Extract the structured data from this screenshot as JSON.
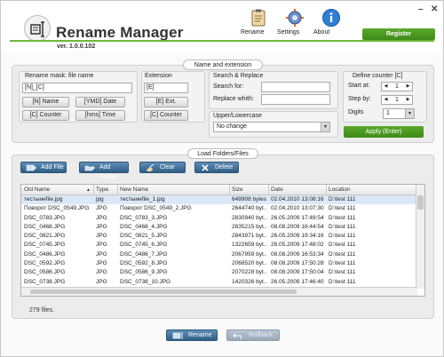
{
  "app": {
    "title": "Rename Manager",
    "version": "ver. 1.0.0.102",
    "window_minimize": "–",
    "window_close": "✕"
  },
  "toolbar": {
    "rename_label": "Rename",
    "settings_label": "Settings",
    "about_label": "About",
    "register_label": "Register"
  },
  "name_ext": {
    "group_title": "Name and extension",
    "mask_label": "Rename mask: file name",
    "mask_value": "[N]_[C]",
    "btn_n_name": "[N] Name",
    "btn_ymd_date": "[YMD] Date",
    "btn_c_counter": "[C] Counter",
    "btn_hms_time": "[hms] Time",
    "extension_label": "Extension",
    "extension_value": "[E]",
    "btn_e_ext": "[E] Ext.",
    "btn_c_counter_ext": "[C] Counter",
    "search_replace_title": "Search & Replace",
    "search_for_label": "Search for:",
    "search_for_value": "",
    "replace_with_label": "Replace whith:",
    "replace_with_value": "",
    "case_title": "Upper/Lowercase",
    "case_value": "No change",
    "counter_title": "Define counter [C]",
    "start_label": "Start at:",
    "start_value": "1",
    "step_label": "Step by:",
    "step_value": "1",
    "digits_label": "Digits",
    "digits_value": "1",
    "apply_label": "Apply (Enter)"
  },
  "load": {
    "group_title": "Load Folders/Files",
    "add_file": "Add File",
    "add_folder": "Add Folder",
    "clear": "Clear",
    "delete": "Delete"
  },
  "table": {
    "columns": [
      "Old Name",
      "Type",
      "New Name",
      "Size",
      "Date",
      "Location"
    ],
    "sort_indicator": "▲",
    "rows": [
      [
        "тестыинfile.jpg",
        "jpg",
        "тестыинfile_1.jpg",
        "649908 bytes",
        "02.04.2010 13:08:16",
        "D:\\test 111"
      ],
      [
        "Поворот DSC_0549.JPG",
        "JPG",
        "Поворот DSC_0549_2.JPG",
        "2644740 byt...",
        "02.04.2010 13:07:30",
        "D:\\test 111"
      ],
      [
        "DSC_0783.JPG",
        "JPG",
        "DSC_0783_3.JPG",
        "2830940 byt...",
        "26.05.2009 17:49:54",
        "D:\\test 111"
      ],
      [
        "DSC_0468.JPG",
        "JPG",
        "DSC_0468_4.JPG",
        "2835215 byt...",
        "08.08.2009 16:44:54",
        "D:\\test 111"
      ],
      [
        "DSC_0821.JPG",
        "JPG",
        "DSC_0821_5.JPG",
        "2843971 byt...",
        "26.05.2009 19:34:16",
        "D:\\test 111"
      ],
      [
        "DSC_0745.JPG",
        "JPG",
        "DSC_0745_6.JPG",
        "1322659 byt...",
        "26.05.2009 17:48:02",
        "D:\\test 111"
      ],
      [
        "DSC_0486.JPG",
        "JPG",
        "DSC_0486_7.JPG",
        "2067959 byt...",
        "08.08.2009 16:53:34",
        "D:\\test 111"
      ],
      [
        "DSC_0592.JPG",
        "JPG",
        "DSC_0592_8.JPG",
        "2068520 byt...",
        "08.08.2009 17:50:28",
        "D:\\test 111"
      ],
      [
        "DSC_0586.JPG",
        "JPG",
        "DSC_0586_9.JPG",
        "2070228 byt...",
        "08.08.2009 17:50:04",
        "D:\\test 111"
      ],
      [
        "DSC_0738.JPG",
        "JPG",
        "DSC_0738_10.JPG",
        "1420326 byt...",
        "26.05.2009 17:46:40",
        "D:\\test 111"
      ]
    ]
  },
  "status": {
    "files_count": "279 files."
  },
  "bottom": {
    "rename_label": "Rename",
    "rollback_label": "Rollback"
  }
}
